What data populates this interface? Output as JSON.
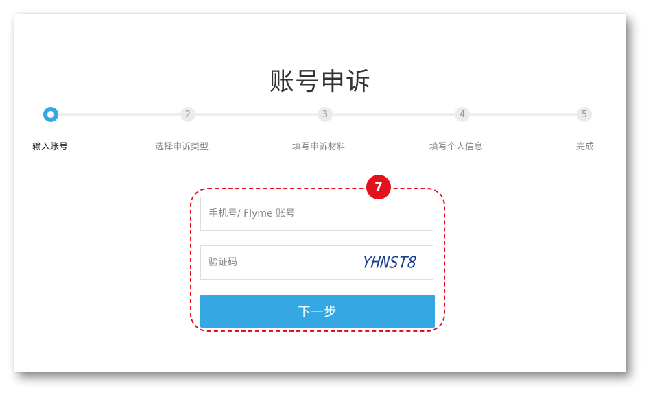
{
  "page": {
    "title": "账号申诉"
  },
  "steps": [
    {
      "number": "1",
      "label": "输入账号",
      "active": true
    },
    {
      "number": "2",
      "label": "选择申诉类型",
      "active": false
    },
    {
      "number": "3",
      "label": "填写申诉材料",
      "active": false
    },
    {
      "number": "4",
      "label": "填写个人信息",
      "active": false
    },
    {
      "number": "5",
      "label": "完成",
      "active": false
    }
  ],
  "form": {
    "account_placeholder": "手机号/ Flyme 账号",
    "account_value": "",
    "captcha_placeholder": "验证码",
    "captcha_value": "",
    "captcha_image_text": "YHNST8",
    "next_label": "下一步"
  },
  "annotation": {
    "badge_number": "7",
    "color": "#e3101e"
  },
  "colors": {
    "accent": "#35a8e4",
    "annotation": "#e3101e"
  }
}
